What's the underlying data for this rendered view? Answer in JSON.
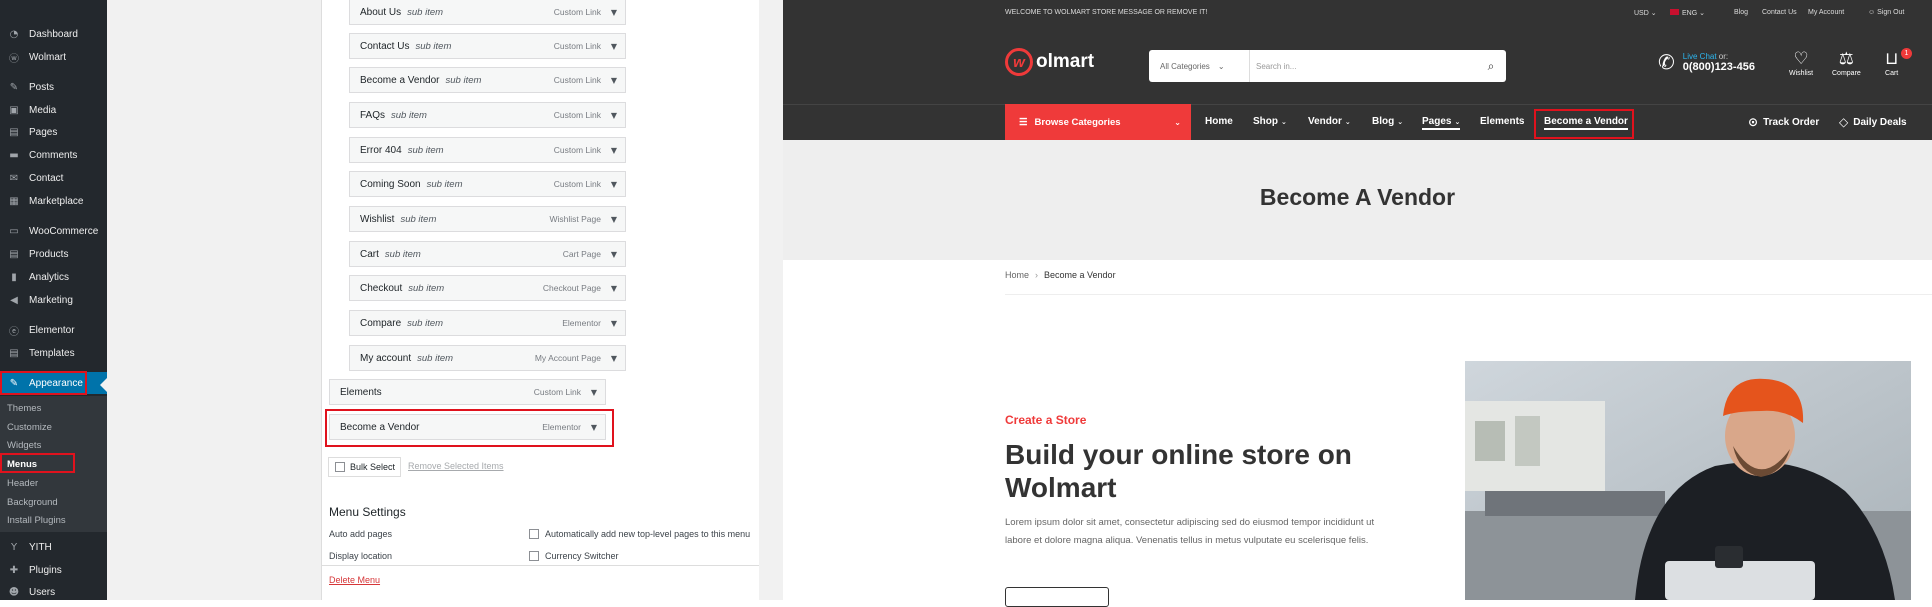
{
  "wp_sidebar": {
    "items": [
      {
        "label": "Dashboard",
        "icon": "dashboard-icon"
      },
      {
        "label": "Wolmart",
        "icon": "wolmart-icon"
      },
      {
        "label": "Posts",
        "icon": "pin-icon"
      },
      {
        "label": "Media",
        "icon": "media-icon"
      },
      {
        "label": "Pages",
        "icon": "page-icon"
      },
      {
        "label": "Comments",
        "icon": "comment-icon"
      },
      {
        "label": "Contact",
        "icon": "mail-icon"
      },
      {
        "label": "Marketplace",
        "icon": "marketplace-icon"
      },
      {
        "label": "WooCommerce",
        "icon": "woocommerce-icon"
      },
      {
        "label": "Products",
        "icon": "products-icon"
      },
      {
        "label": "Analytics",
        "icon": "analytics-icon"
      },
      {
        "label": "Marketing",
        "icon": "megaphone-icon"
      },
      {
        "label": "Elementor",
        "icon": "elementor-icon"
      },
      {
        "label": "Templates",
        "icon": "templates-icon"
      },
      {
        "label": "Appearance",
        "icon": "brush-icon"
      },
      {
        "label": "YITH",
        "icon": "yith-icon"
      },
      {
        "label": "Plugins",
        "icon": "plugin-icon"
      },
      {
        "label": "Users",
        "icon": "users-icon"
      }
    ],
    "appearance_sub": [
      "Themes",
      "Customize",
      "Widgets",
      "Menus",
      "Header",
      "Background",
      "Install Plugins"
    ]
  },
  "menu_items": [
    {
      "label": "About Us",
      "sub": "sub item",
      "type": "Custom Link"
    },
    {
      "label": "Contact Us",
      "sub": "sub item",
      "type": "Custom Link"
    },
    {
      "label": "Become a Vendor",
      "sub": "sub item",
      "type": "Custom Link"
    },
    {
      "label": "FAQs",
      "sub": "sub item",
      "type": "Custom Link"
    },
    {
      "label": "Error 404",
      "sub": "sub item",
      "type": "Custom Link"
    },
    {
      "label": "Coming Soon",
      "sub": "sub item",
      "type": "Custom Link"
    },
    {
      "label": "Wishlist",
      "sub": "sub item",
      "type": "Wishlist Page"
    },
    {
      "label": "Cart",
      "sub": "sub item",
      "type": "Cart Page"
    },
    {
      "label": "Checkout",
      "sub": "sub item",
      "type": "Checkout Page"
    },
    {
      "label": "Compare",
      "sub": "sub item",
      "type": "Elementor"
    },
    {
      "label": "My account",
      "sub": "sub item",
      "type": "My Account Page"
    },
    {
      "label": "Elements",
      "sub": "",
      "type": "Custom Link"
    },
    {
      "label": "Become a Vendor",
      "sub": "",
      "type": "Elementor"
    }
  ],
  "bulk_select": "Bulk Select",
  "remove_selected": "Remove Selected Items",
  "menu_settings": {
    "title": "Menu Settings",
    "auto_add_label": "Auto add pages",
    "auto_add_option": "Automatically add new top-level pages to this menu",
    "display_location_label": "Display location",
    "display_location_option": "Currency Switcher",
    "delete": "Delete Menu"
  },
  "store": {
    "topbar": {
      "welcome": "WELCOME TO WOLMART STORE MESSAGE OR REMOVE IT!",
      "currency": "USD",
      "language": "ENG",
      "links": [
        "Blog",
        "Contact Us",
        "My Account"
      ],
      "signout": "Sign Out"
    },
    "logo": "olmart",
    "logo_mark": "w",
    "search": {
      "category": "All Categories",
      "placeholder": "Search in..."
    },
    "live_chat": {
      "label": "Live Chat",
      "suffix": "or:",
      "phone": "0(800)123-456"
    },
    "header_icons": [
      {
        "label": "Wishlist",
        "icon": "heart-icon"
      },
      {
        "label": "Compare",
        "icon": "compare-icon"
      },
      {
        "label": "Cart",
        "icon": "cart-icon"
      }
    ],
    "cart_count": "1",
    "browse_categories": "Browse Categories",
    "nav": [
      "Home",
      "Shop",
      "Vendor",
      "Blog",
      "Pages",
      "Elements",
      "Become a Vendor"
    ],
    "nav_right": [
      "Track Order",
      "Daily Deals"
    ],
    "hero_title": "Become A Vendor",
    "breadcrumb": {
      "home": "Home",
      "current": "Become a Vendor"
    },
    "tagline": "Create a Store",
    "headline": "Build your online store on Wolmart",
    "paragraph": "Lorem ipsum dolor sit amet, consectetur adipiscing sed do eiusmod tempor incididunt ut labore et dolore magna aliqua. Venenatis tellus in metus vulputate eu scelerisque felis."
  },
  "colors": {
    "accent": "#ef3a3a",
    "wp_blue": "#0073aa",
    "highlight_box": "#e0121d"
  }
}
